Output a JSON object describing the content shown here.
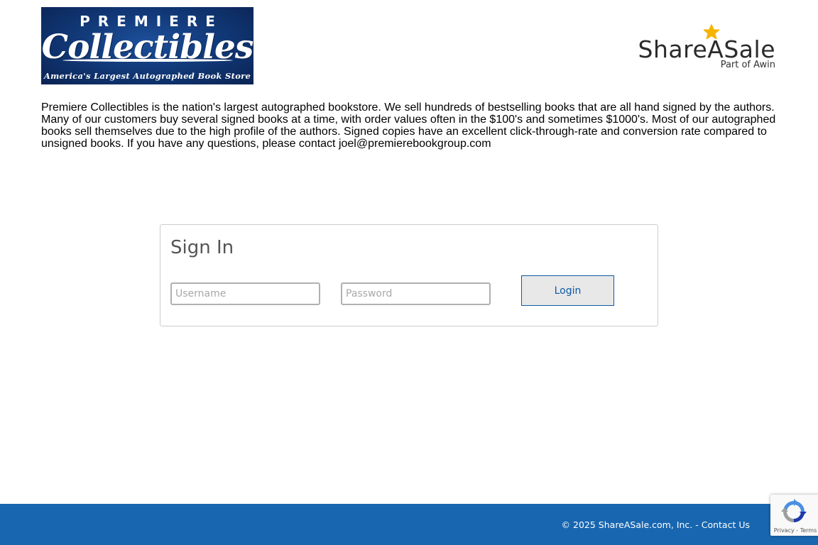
{
  "merchant": {
    "logo_top": "PREMIERE",
    "logo_script": "Collectibles",
    "logo_tagline": "America's Largest Autographed Book Store",
    "description": "Premiere Collectibles is the nation's largest autographed bookstore. We sell hundreds of bestselling books that are all hand signed by the authors. Many of our customers buy several signed books at a time, with order values often in the $100's and sometimes $1000's. Most of our autographed books sell themselves due to the high profile of the authors. Signed copies have an excellent click-through-rate and conversion rate compared to unsigned books. If you have any questions, please contact joel@premierebookgroup.com"
  },
  "network": {
    "name": "ShareASale",
    "subtitle": "Part of Awin",
    "star_color": "#f5b400"
  },
  "signin": {
    "title": "Sign In",
    "username_placeholder": "Username",
    "username_value": "",
    "password_placeholder": "Password",
    "password_value": "",
    "login_label": "Login"
  },
  "footer": {
    "copyright": "© 2025 ShareASale.com, Inc. - ",
    "contact_label": "Contact Us",
    "background": "#1866b0"
  },
  "recaptcha": {
    "links": "Privacy - Terms",
    "icon": "recaptcha-icon"
  }
}
